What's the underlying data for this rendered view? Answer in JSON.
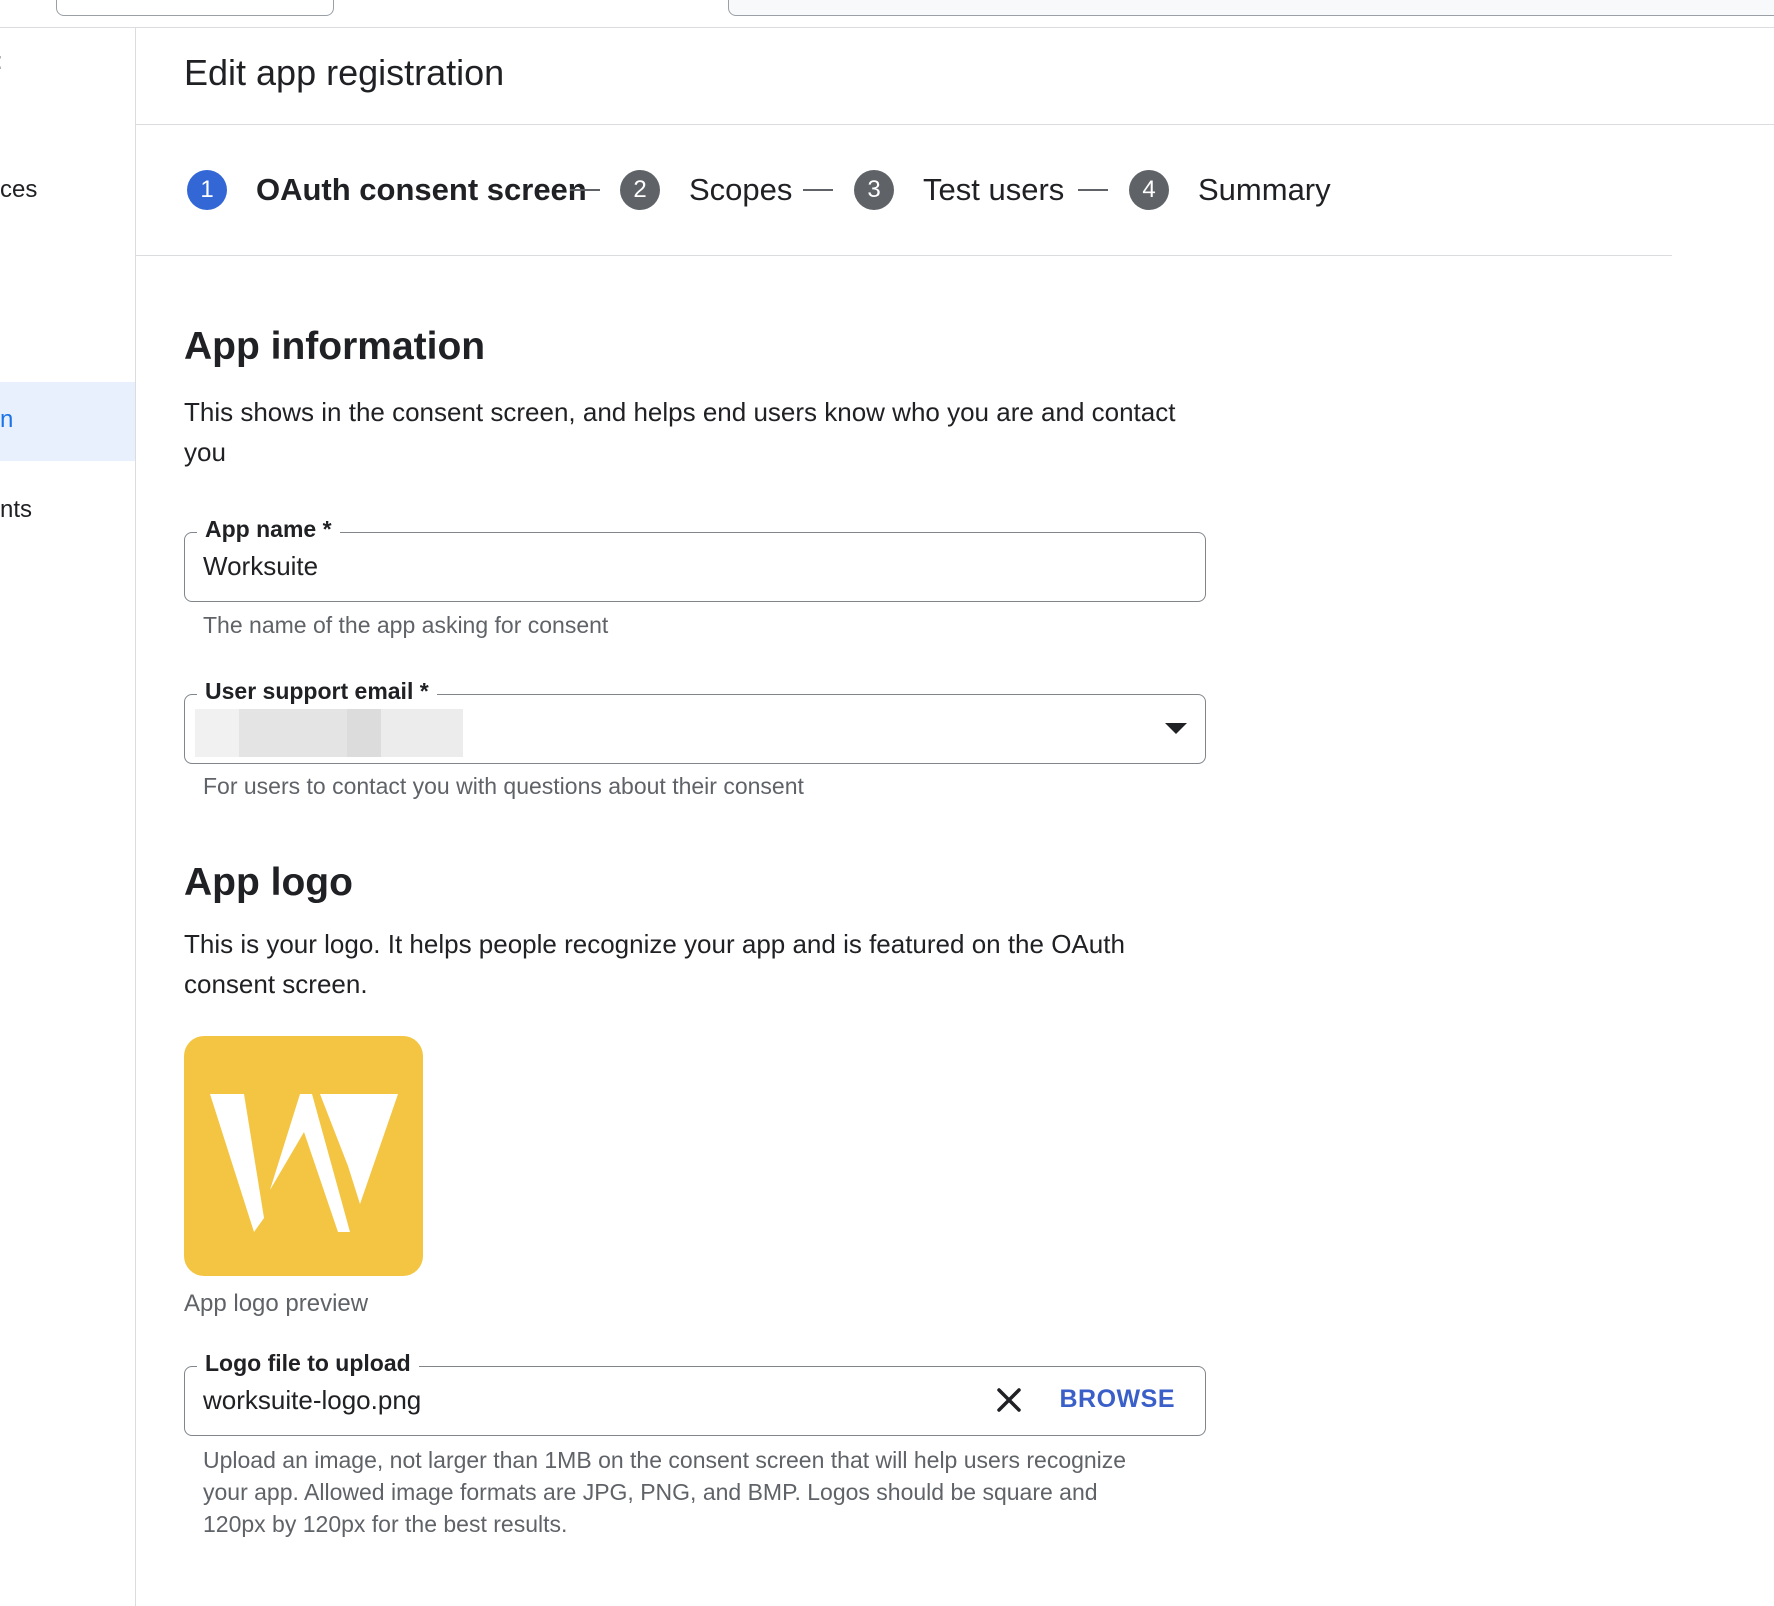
{
  "sidebar": {
    "items": [
      {
        "label": "ces",
        "active": false
      },
      {
        "label": "n",
        "active": true
      },
      {
        "label": "nts",
        "active": false
      }
    ]
  },
  "header": {
    "title": "Edit app registration"
  },
  "stepper": {
    "steps": [
      {
        "number": "1",
        "label": "OAuth consent screen",
        "state": "active"
      },
      {
        "number": "2",
        "label": "Scopes",
        "state": "inactive"
      },
      {
        "number": "3",
        "label": "Test users",
        "state": "inactive"
      },
      {
        "number": "4",
        "label": "Summary",
        "state": "inactive"
      }
    ]
  },
  "app_information": {
    "heading": "App information",
    "description": "This shows in the consent screen, and helps end users know who you are and contact you"
  },
  "app_name": {
    "label": "App name *",
    "value": "Worksuite",
    "helper": "The name of the app asking for consent"
  },
  "support_email": {
    "label": "User support email *",
    "value_redacted": true,
    "helper": "For users to contact you with questions about their consent"
  },
  "app_logo": {
    "heading": "App logo",
    "description": "This is your logo. It helps people recognize your app and is featured on the OAuth consent screen.",
    "preview_caption": "App logo preview",
    "logo_icon": "worksuite-w-logo",
    "logo_color": "#f4c542"
  },
  "logo_upload": {
    "label": "Logo file to upload",
    "value": "worksuite-logo.png",
    "browse_label": "BROWSE",
    "helper_lines": [
      "Upload an image, not larger than 1MB on the consent screen that will help users recognize",
      "your app. Allowed image formats are JPG, PNG, and BMP. Logos should be square and",
      "120px by 120px for the best results."
    ]
  },
  "colors": {
    "active_step": "#3367d6",
    "inactive_step": "#5f6368",
    "accent": "#3a5fc8",
    "sidebar_active_bg": "#e8f0fe"
  }
}
